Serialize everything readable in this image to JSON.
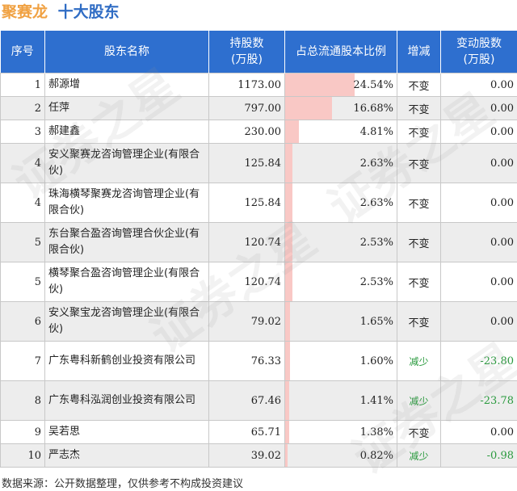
{
  "header": {
    "company": "聚赛龙",
    "section": "十大股东"
  },
  "table": {
    "columns": [
      "序号",
      "股东名称",
      "持股数\n(万股)",
      "占总流通股本比例",
      "增减",
      "变动股数\n(万股)"
    ],
    "rows": [
      {
        "rank": "1",
        "name": "郝源增",
        "shares": "1173.00",
        "ratio": "24.54%",
        "change": "不变",
        "delta": "0.00"
      },
      {
        "rank": "2",
        "name": "任萍",
        "shares": "797.00",
        "ratio": "16.68%",
        "change": "不变",
        "delta": "0.00"
      },
      {
        "rank": "3",
        "name": "郝建鑫",
        "shares": "230.00",
        "ratio": "4.81%",
        "change": "不变",
        "delta": "0.00"
      },
      {
        "rank": "4",
        "name": "安义聚赛龙咨询管理企业(有限合伙)",
        "shares": "125.84",
        "ratio": "2.63%",
        "change": "不变",
        "delta": "0.00"
      },
      {
        "rank": "4",
        "name": "珠海横琴聚赛龙咨询管理企业(有限合伙)",
        "shares": "125.84",
        "ratio": "2.63%",
        "change": "不变",
        "delta": "0.00"
      },
      {
        "rank": "5",
        "name": "东台聚合盈咨询管理合伙企业(有限合伙)",
        "shares": "120.74",
        "ratio": "2.53%",
        "change": "不变",
        "delta": "0.00"
      },
      {
        "rank": "5",
        "name": "横琴聚合盈咨询管理企业(有限合伙)",
        "shares": "120.74",
        "ratio": "2.53%",
        "change": "不变",
        "delta": "0.00"
      },
      {
        "rank": "6",
        "name": "安义聚宝龙咨询管理企业(有限合伙)",
        "shares": "79.02",
        "ratio": "1.65%",
        "change": "不变",
        "delta": "0.00"
      },
      {
        "rank": "7",
        "name": "广东粤科新鹤创业投资有限公司",
        "shares": "76.33",
        "ratio": "1.60%",
        "change": "减少",
        "delta": "-23.80"
      },
      {
        "rank": "8",
        "name": "广东粤科泓润创业投资有限公司",
        "shares": "67.46",
        "ratio": "1.41%",
        "change": "减少",
        "delta": "-23.78"
      },
      {
        "rank": "9",
        "name": "吴若思",
        "shares": "65.71",
        "ratio": "1.38%",
        "change": "不变",
        "delta": "0.00"
      },
      {
        "rank": "10",
        "name": "严志杰",
        "shares": "39.02",
        "ratio": "0.82%",
        "change": "减少",
        "delta": "-0.98"
      }
    ]
  },
  "ratio_fractions": [
    0.2454,
    0.1668,
    0.0481,
    0.0263,
    0.0263,
    0.0253,
    0.0253,
    0.0165,
    0.016,
    0.0141,
    0.0138,
    0.0082
  ],
  "footer": {
    "source": "数据来源：公开数据整理，仅供参考不构成投资建议"
  },
  "watermark": "证券之星",
  "colors": {
    "header_bg": "#2e6fcf",
    "bar": "#f9c8c5",
    "decrease": "#2a9a3e",
    "company": "#f0a142",
    "section": "#2f6cc4"
  }
}
